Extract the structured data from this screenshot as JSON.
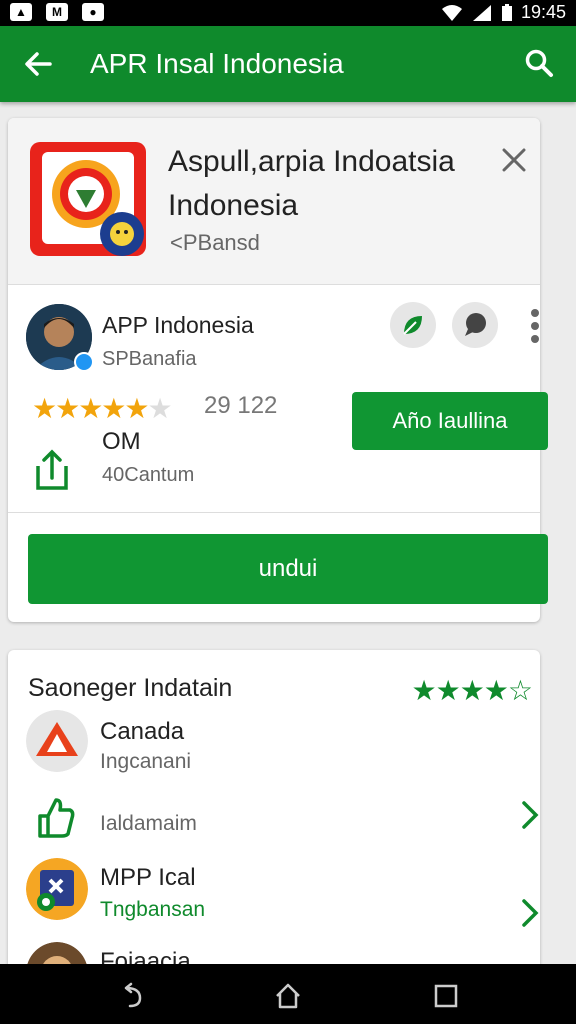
{
  "status_bar": {
    "time": "19:45"
  },
  "app_bar": {
    "title": "APR Insal Indonesia"
  },
  "hero": {
    "title": "Aspull,arpia Indoatsia Indonesia",
    "subtitle": "<PBansd"
  },
  "developer": {
    "name": "APP Indonesia",
    "subtitle": "SPBanafia",
    "rating_count": "29 122",
    "size": "OM",
    "downloads": "40Cantum",
    "action_label": "Año Iaullina"
  },
  "install_label": "undui",
  "section": {
    "title": "Saoneger Indatain",
    "items": [
      {
        "title": "Canada",
        "subtitle": "Ingcanani"
      },
      {
        "title": "",
        "subtitle": "Ialdamaim"
      },
      {
        "title": "MPP Ical",
        "subtitle": "Tngbansan"
      },
      {
        "title": "Foiaacia",
        "subtitle": ""
      }
    ]
  },
  "colors": {
    "brand": "#0f8a2c",
    "button": "#109633",
    "star": "#f2a40c"
  }
}
